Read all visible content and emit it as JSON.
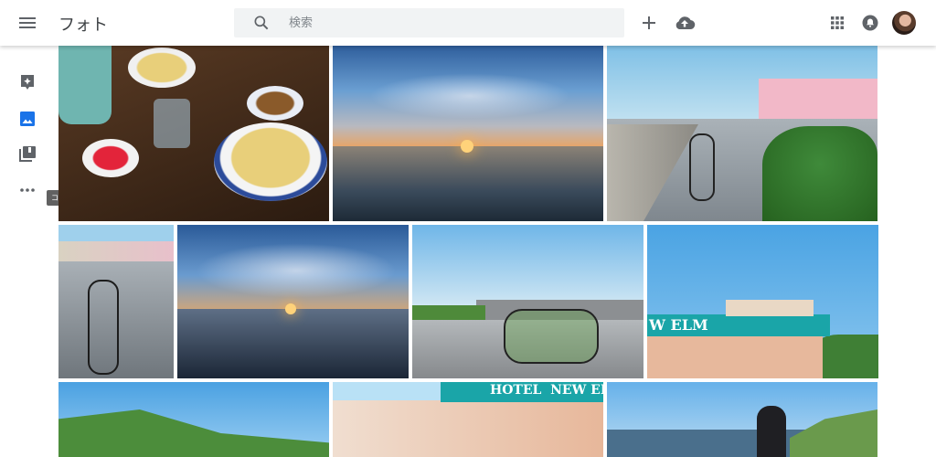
{
  "app": {
    "title": "フォト"
  },
  "search": {
    "placeholder": "検索"
  },
  "sidebar": {
    "tooltip": "コレクション",
    "items": [
      {
        "icon": "assistant-icon"
      },
      {
        "icon": "photos-icon",
        "active": true
      },
      {
        "icon": "collections-icon"
      },
      {
        "icon": "more-icon"
      }
    ]
  },
  "toolbar": {
    "icons": [
      "add-icon",
      "upload-icon",
      "apps-icon",
      "notifications-icon",
      "avatar"
    ]
  },
  "photos": {
    "row1": [
      "fried-rice-meal",
      "sunset-over-sea",
      "seaside-road-with-bicycles"
    ],
    "row2": [
      "bicycles-on-pavement",
      "cloudy-sunset-reflection",
      "breakwater-bicycles",
      "hotel-building-sign"
    ],
    "row3": [
      "green-hills-lake",
      "hotel-new-elm-facade",
      "person-by-seaside"
    ],
    "signs": {
      "hotel_partial": "W ELM",
      "hotel_full": "HOTEL  NEW ELM"
    }
  },
  "colors": {
    "accent": "#1a73e8",
    "icon": "#5f6368"
  }
}
